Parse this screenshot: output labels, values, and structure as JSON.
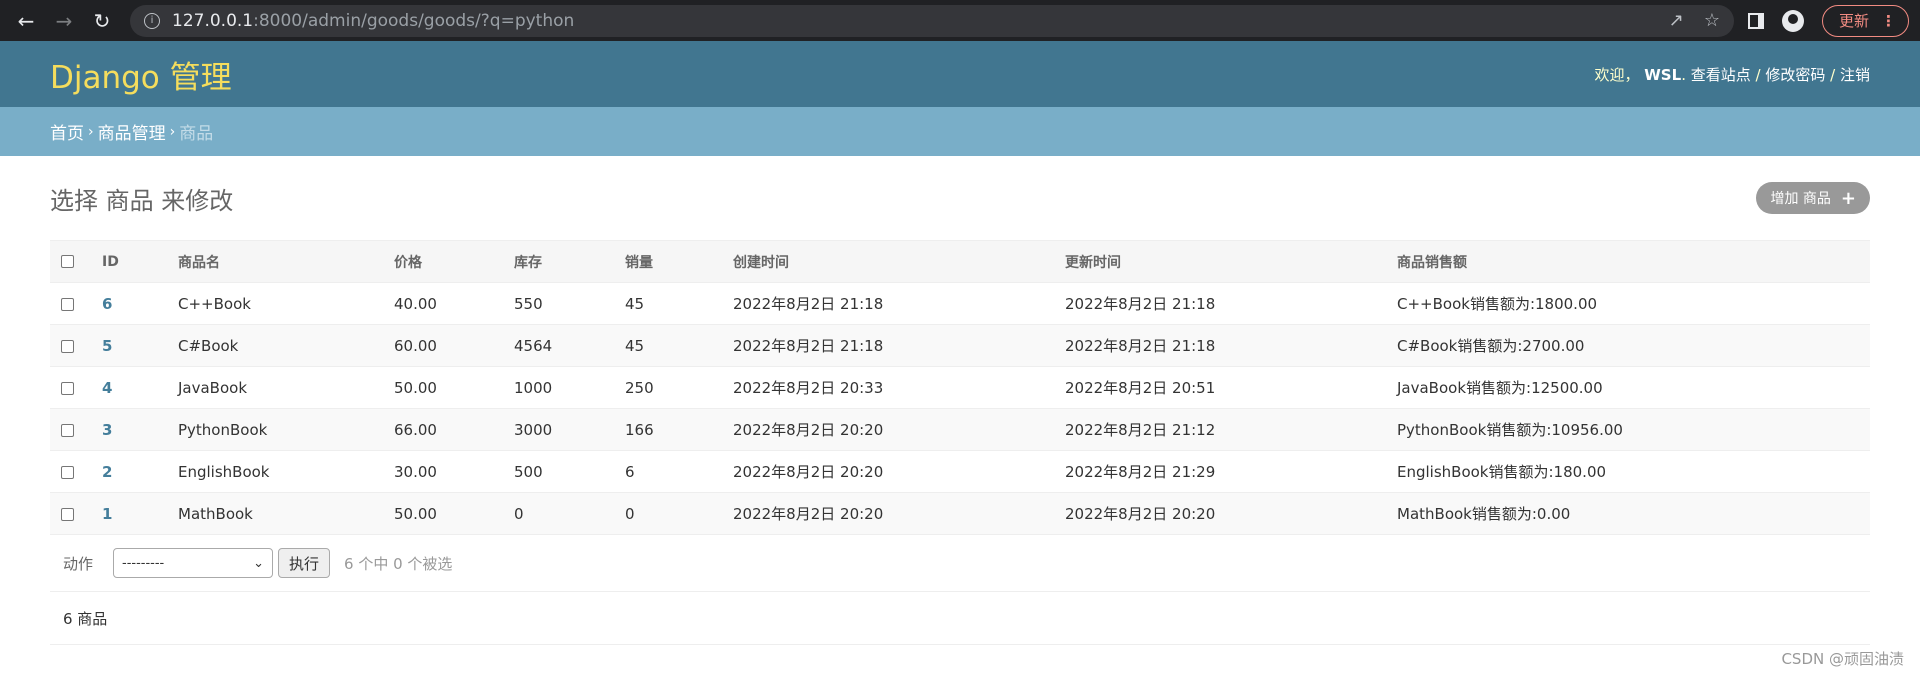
{
  "browser": {
    "url_host": "127.0.0.1",
    "url_rest": ":8000/admin/goods/goods/?q=python",
    "update_label": "更新"
  },
  "header": {
    "brand": "Django 管理",
    "welcome": "欢迎，",
    "username": "WSL",
    "view_site": "查看站点",
    "change_password": "修改密码",
    "logout": "注销"
  },
  "breadcrumbs": {
    "home": "首页",
    "app": "商品管理",
    "current": "商品"
  },
  "page": {
    "title": "选择 商品 来修改",
    "add_button": "增加 商品"
  },
  "table": {
    "columns": [
      "ID",
      "商品名",
      "价格",
      "库存",
      "销量",
      "创建时间",
      "更新时间",
      "商品销售额"
    ],
    "rows": [
      {
        "id": "6",
        "name": "C++Book",
        "price": "40.00",
        "stock": "550",
        "sales": "45",
        "created": "2022年8月2日 21:18",
        "updated": "2022年8月2日 21:18",
        "revenue": "C++Book销售额为:1800.00"
      },
      {
        "id": "5",
        "name": "C#Book",
        "price": "60.00",
        "stock": "4564",
        "sales": "45",
        "created": "2022年8月2日 21:18",
        "updated": "2022年8月2日 21:18",
        "revenue": "C#Book销售额为:2700.00"
      },
      {
        "id": "4",
        "name": "JavaBook",
        "price": "50.00",
        "stock": "1000",
        "sales": "250",
        "created": "2022年8月2日 20:33",
        "updated": "2022年8月2日 20:51",
        "revenue": "JavaBook销售额为:12500.00"
      },
      {
        "id": "3",
        "name": "PythonBook",
        "price": "66.00",
        "stock": "3000",
        "sales": "166",
        "created": "2022年8月2日 20:20",
        "updated": "2022年8月2日 21:12",
        "revenue": "PythonBook销售额为:10956.00"
      },
      {
        "id": "2",
        "name": "EnglishBook",
        "price": "30.00",
        "stock": "500",
        "sales": "6",
        "created": "2022年8月2日 20:20",
        "updated": "2022年8月2日 21:29",
        "revenue": "EnglishBook销售额为:180.00"
      },
      {
        "id": "1",
        "name": "MathBook",
        "price": "50.00",
        "stock": "0",
        "sales": "0",
        "created": "2022年8月2日 20:20",
        "updated": "2022年8月2日 20:20",
        "revenue": "MathBook销售额为:0.00"
      }
    ]
  },
  "actions": {
    "label": "动作",
    "selected_option": "---------",
    "go_button": "执行",
    "selected_count": "6 个中 0 个被选"
  },
  "paginator": {
    "count": "6 商品"
  },
  "watermark": "CSDN @顽固油渍"
}
